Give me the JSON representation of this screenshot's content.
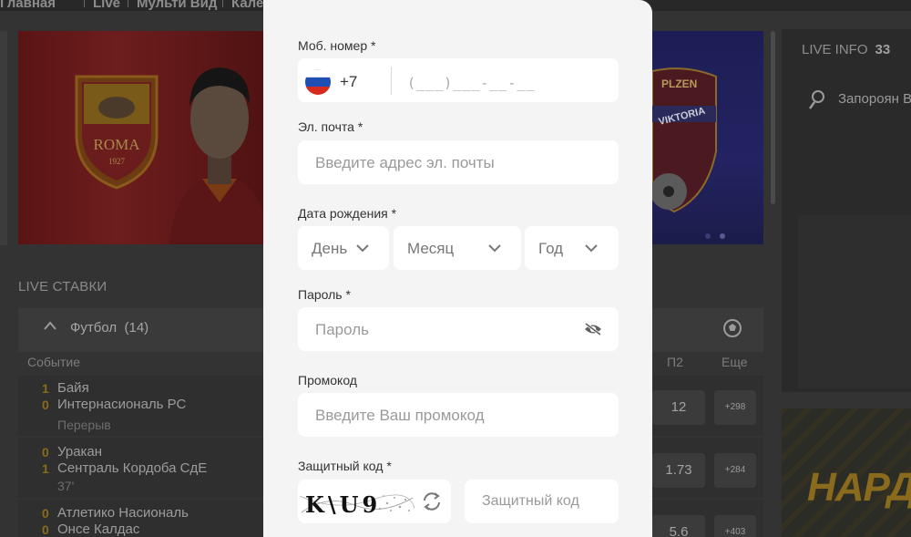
{
  "background": {
    "nav": [
      "Главная",
      "Live",
      "Мульти Вид",
      "Кале"
    ],
    "live_info": {
      "label": "LIVE INFO",
      "count": "33"
    },
    "featured_player": "Запороян В",
    "live_stavki": "LIVE СТАВКИ",
    "sport": {
      "name": "Футбол",
      "count": "(14)"
    },
    "columns": {
      "event": "Событие",
      "p2": "П2",
      "more": "Еще"
    },
    "matches": [
      {
        "score1": "1",
        "team1": "Байя",
        "score2": "0",
        "team2": "Интернасиональ РС",
        "status": "Перерыв",
        "p2": "12",
        "more": "+298"
      },
      {
        "score1": "0",
        "team1": "Уракан",
        "score2": "1",
        "team2": "Сентраль Кордоба СдЕ",
        "status": "37'",
        "p2": "1.73",
        "more": "+284"
      },
      {
        "score1": "0",
        "team1": "Атлетико Насиональ",
        "score2": "0",
        "team2": "Онсе Калдас",
        "status": "",
        "p2": "5.6",
        "more": "+403"
      }
    ],
    "promo_text": "НАРД",
    "crest_roma": {
      "name": "ROMA",
      "year": "1927"
    },
    "crest_plzen": {
      "top": "PLZEN",
      "band": "VIKTORIA"
    }
  },
  "form": {
    "phone": {
      "label": "Моб. номер *",
      "country_code": "+7",
      "flag": "russia-flag-icon",
      "placeholder": "(___)___-__-__"
    },
    "email": {
      "label": "Эл. почта *",
      "placeholder": "Введите адрес эл. почты"
    },
    "birthdate": {
      "label": "Дата рождения *",
      "day": "День",
      "month": "Месяц",
      "year": "Год"
    },
    "password": {
      "label": "Пароль *",
      "placeholder": "Пароль",
      "toggle_icon": "eye-off-icon"
    },
    "promo": {
      "label": "Промокод",
      "placeholder": "Введите Ваш промокод"
    },
    "captcha": {
      "label": "Защитный код *",
      "image_text": "K\\U9",
      "placeholder": "Защитный код",
      "refresh_icon": "refresh-icon"
    }
  },
  "colors": {
    "modal_bg": "#f4f4f4",
    "field_bg": "#ffffff",
    "overlay_bg": "#333333",
    "accent_score": "#8a6b1c"
  }
}
